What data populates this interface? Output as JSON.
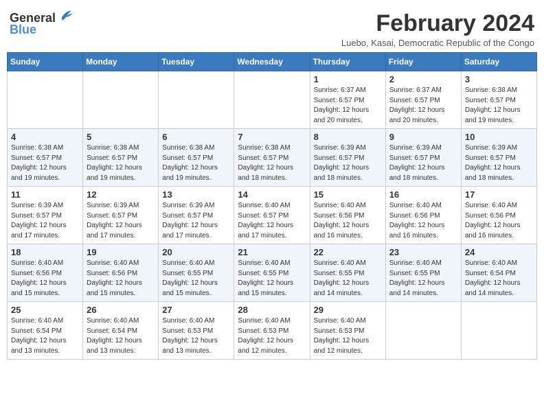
{
  "header": {
    "logo_general": "General",
    "logo_blue": "Blue",
    "title": "February 2024",
    "location": "Luebo, Kasai, Democratic Republic of the Congo"
  },
  "days_of_week": [
    "Sunday",
    "Monday",
    "Tuesday",
    "Wednesday",
    "Thursday",
    "Friday",
    "Saturday"
  ],
  "weeks": [
    [
      {
        "day": "",
        "content": ""
      },
      {
        "day": "",
        "content": ""
      },
      {
        "day": "",
        "content": ""
      },
      {
        "day": "",
        "content": ""
      },
      {
        "day": "1",
        "content": "Sunrise: 6:37 AM\nSunset: 6:57 PM\nDaylight: 12 hours and 20 minutes."
      },
      {
        "day": "2",
        "content": "Sunrise: 6:37 AM\nSunset: 6:57 PM\nDaylight: 12 hours and 20 minutes."
      },
      {
        "day": "3",
        "content": "Sunrise: 6:38 AM\nSunset: 6:57 PM\nDaylight: 12 hours and 19 minutes."
      }
    ],
    [
      {
        "day": "4",
        "content": "Sunrise: 6:38 AM\nSunset: 6:57 PM\nDaylight: 12 hours and 19 minutes."
      },
      {
        "day": "5",
        "content": "Sunrise: 6:38 AM\nSunset: 6:57 PM\nDaylight: 12 hours and 19 minutes."
      },
      {
        "day": "6",
        "content": "Sunrise: 6:38 AM\nSunset: 6:57 PM\nDaylight: 12 hours and 19 minutes."
      },
      {
        "day": "7",
        "content": "Sunrise: 6:38 AM\nSunset: 6:57 PM\nDaylight: 12 hours and 18 minutes."
      },
      {
        "day": "8",
        "content": "Sunrise: 6:39 AM\nSunset: 6:57 PM\nDaylight: 12 hours and 18 minutes."
      },
      {
        "day": "9",
        "content": "Sunrise: 6:39 AM\nSunset: 6:57 PM\nDaylight: 12 hours and 18 minutes."
      },
      {
        "day": "10",
        "content": "Sunrise: 6:39 AM\nSunset: 6:57 PM\nDaylight: 12 hours and 18 minutes."
      }
    ],
    [
      {
        "day": "11",
        "content": "Sunrise: 6:39 AM\nSunset: 6:57 PM\nDaylight: 12 hours and 17 minutes."
      },
      {
        "day": "12",
        "content": "Sunrise: 6:39 AM\nSunset: 6:57 PM\nDaylight: 12 hours and 17 minutes."
      },
      {
        "day": "13",
        "content": "Sunrise: 6:39 AM\nSunset: 6:57 PM\nDaylight: 12 hours and 17 minutes."
      },
      {
        "day": "14",
        "content": "Sunrise: 6:40 AM\nSunset: 6:57 PM\nDaylight: 12 hours and 17 minutes."
      },
      {
        "day": "15",
        "content": "Sunrise: 6:40 AM\nSunset: 6:56 PM\nDaylight: 12 hours and 16 minutes."
      },
      {
        "day": "16",
        "content": "Sunrise: 6:40 AM\nSunset: 6:56 PM\nDaylight: 12 hours and 16 minutes."
      },
      {
        "day": "17",
        "content": "Sunrise: 6:40 AM\nSunset: 6:56 PM\nDaylight: 12 hours and 16 minutes."
      }
    ],
    [
      {
        "day": "18",
        "content": "Sunrise: 6:40 AM\nSunset: 6:56 PM\nDaylight: 12 hours and 15 minutes."
      },
      {
        "day": "19",
        "content": "Sunrise: 6:40 AM\nSunset: 6:56 PM\nDaylight: 12 hours and 15 minutes."
      },
      {
        "day": "20",
        "content": "Sunrise: 6:40 AM\nSunset: 6:55 PM\nDaylight: 12 hours and 15 minutes."
      },
      {
        "day": "21",
        "content": "Sunrise: 6:40 AM\nSunset: 6:55 PM\nDaylight: 12 hours and 15 minutes."
      },
      {
        "day": "22",
        "content": "Sunrise: 6:40 AM\nSunset: 6:55 PM\nDaylight: 12 hours and 14 minutes."
      },
      {
        "day": "23",
        "content": "Sunrise: 6:40 AM\nSunset: 6:55 PM\nDaylight: 12 hours and 14 minutes."
      },
      {
        "day": "24",
        "content": "Sunrise: 6:40 AM\nSunset: 6:54 PM\nDaylight: 12 hours and 14 minutes."
      }
    ],
    [
      {
        "day": "25",
        "content": "Sunrise: 6:40 AM\nSunset: 6:54 PM\nDaylight: 12 hours and 13 minutes."
      },
      {
        "day": "26",
        "content": "Sunrise: 6:40 AM\nSunset: 6:54 PM\nDaylight: 12 hours and 13 minutes."
      },
      {
        "day": "27",
        "content": "Sunrise: 6:40 AM\nSunset: 6:53 PM\nDaylight: 12 hours and 13 minutes."
      },
      {
        "day": "28",
        "content": "Sunrise: 6:40 AM\nSunset: 6:53 PM\nDaylight: 12 hours and 12 minutes."
      },
      {
        "day": "29",
        "content": "Sunrise: 6:40 AM\nSunset: 6:53 PM\nDaylight: 12 hours and 12 minutes."
      },
      {
        "day": "",
        "content": ""
      },
      {
        "day": "",
        "content": ""
      }
    ]
  ]
}
